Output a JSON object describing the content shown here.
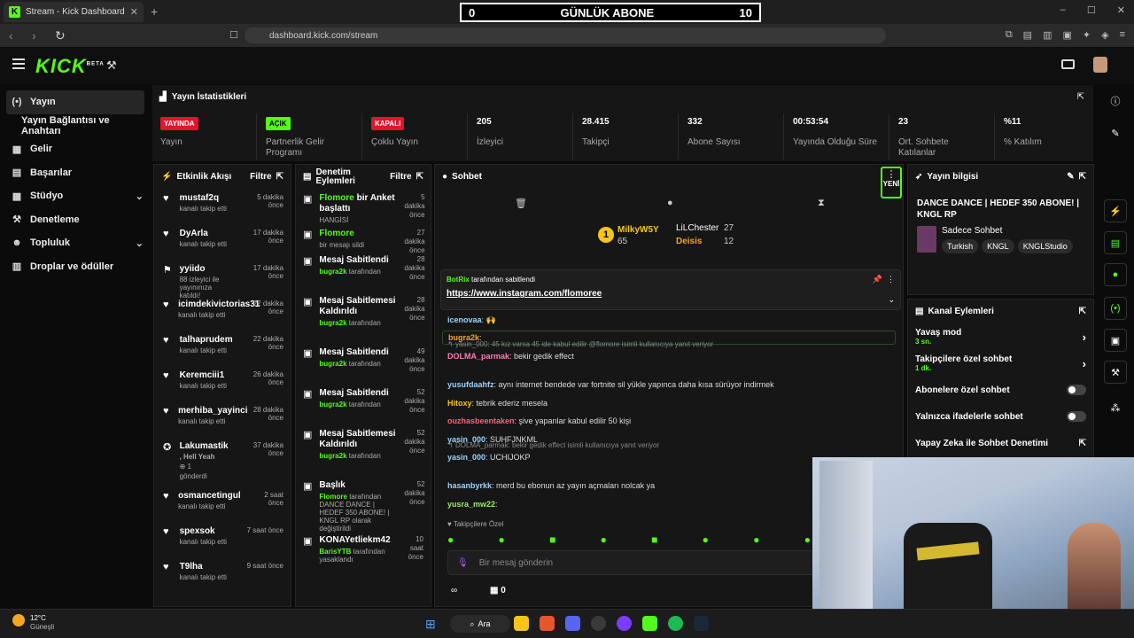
{
  "browser": {
    "tab_title": "Stream - Kick Dashboard",
    "tab_close": "✕",
    "new_tab": "+",
    "url": "dashboard.kick.com/stream",
    "win_min": "–",
    "win_max": "☐",
    "win_close": "✕"
  },
  "overlay": {
    "left": "0",
    "title": "GÜNLÜK ABONE",
    "right": "10"
  },
  "header": {
    "logo": "KICK",
    "logo_sup": "BETA"
  },
  "sidebar": {
    "items": [
      {
        "label": "Yayın",
        "icon": "(•)"
      },
      {
        "label": "Yayın Bağlantısı ve Anahtarı",
        "icon": ""
      },
      {
        "label": "Gelir",
        "icon": "▦"
      },
      {
        "label": "Başarılar",
        "icon": "▤"
      },
      {
        "label": "Stüdyo",
        "icon": "▦"
      },
      {
        "label": "Denetleme",
        "icon": "⚒"
      },
      {
        "label": "Topluluk",
        "icon": "☻"
      },
      {
        "label": "Droplar ve ödüller",
        "icon": "▥"
      }
    ]
  },
  "stats": {
    "title": "Yayın İstatistikleri",
    "items": [
      {
        "badge": "YAYINDA",
        "badge_color": "#e0162b",
        "label": "Yayın"
      },
      {
        "badge": "AÇIK",
        "badge_color": "#53fc18",
        "label": "Partnerlik Gelir Programı"
      },
      {
        "badge": "KAPALI",
        "badge_color": "#e0162b",
        "label": "Çoklu Yayın"
      },
      {
        "value": "205",
        "label": "İzleyici"
      },
      {
        "value": "28.415",
        "label": "Takipçi"
      },
      {
        "value": "332",
        "label": "Abone Sayısı"
      },
      {
        "value": "00:53:54",
        "label": "Yayında Olduğu Süre"
      },
      {
        "value": "23",
        "label": "Ort. Sohbete Katılanlar"
      },
      {
        "value": "%11",
        "label": "% Katılım"
      }
    ]
  },
  "activity": {
    "title": "Etkinlik Akışı",
    "filter": "Filtre",
    "events": [
      {
        "name": "mustaf2q",
        "sub": "kanalı takip etti",
        "time": "5 dakika önce"
      },
      {
        "name": "DyArla",
        "sub": "kanalı takip etti",
        "time": "17 dakika önce"
      },
      {
        "name": "yyiido",
        "sub": "88 izleyici ile yayınınıza katıldı!",
        "time": "17 dakika önce"
      },
      {
        "name": "icimdekivictorias31",
        "sub": "kanalı takip etti",
        "time": "22 dakika önce"
      },
      {
        "name": "talhaprudem",
        "sub": "kanalı takip etti",
        "time": "22 dakika önce"
      },
      {
        "name": "Keremciii1",
        "sub": "kanalı takip etti",
        "time": "26 dakika önce"
      },
      {
        "name": "merhiba_yayinci",
        "sub": "kanalı takip etti",
        "time": "28 dakika önce"
      },
      {
        "name": "Lakumastik",
        "sub": ", Hell Yeah",
        "sub2": "1",
        "sub3": "gönderdi",
        "time": "37 dakika önce"
      },
      {
        "name": "osmancetingul",
        "sub": "kanalı takip etti",
        "time": "2 saat önce"
      },
      {
        "name": "spexsok",
        "sub": "kanalı takip etti",
        "time": "7 saat önce"
      },
      {
        "name": "T9lha",
        "sub": "kanalı takip etti",
        "time": "9 saat önce"
      }
    ]
  },
  "modlog": {
    "title": "Denetim Eylemleri",
    "filter": "Filtre",
    "items": [
      {
        "title1": "Flomore",
        "title2": " bir Anket başlattı",
        "sub": "HANGİSİ",
        "time": "5 dakika önce"
      },
      {
        "title1": "Flomore",
        "title2": "",
        "sub": "bir mesajı sildi",
        "time": "27 dakika önce"
      },
      {
        "title1": "Mesaj Sabitlendi",
        "by": "bugra2k",
        "sub": " tarafından",
        "time": "28 dakika önce"
      },
      {
        "title1": "Mesaj Sabitlemesi Kaldırıldı",
        "by": "bugra2k",
        "sub": " tarafından",
        "time": "28 dakika önce"
      },
      {
        "title1": "Mesaj Sabitlendi",
        "by": "bugra2k",
        "sub": " tarafından",
        "time": "49 dakika önce"
      },
      {
        "title1": "Mesaj Sabitlendi",
        "by": "bugra2k",
        "sub": " tarafından",
        "time": "52 dakika önce"
      },
      {
        "title1": "Mesaj Sabitlemesi Kaldırıldı",
        "by": "bugra2k",
        "sub": " tarafından",
        "time": "52 dakika önce"
      },
      {
        "title1": "Başlık",
        "by": "Flomore",
        "sub": " tarafından DANCE DANCE | HEDEF 350 ABONE! | KNGL RP olarak değiştirildi",
        "time": "52 dakika önce"
      },
      {
        "title1": "KONAYetliekm42",
        "by": "BarisYTB",
        "sub": " tarafından yasaklandı",
        "time": "10 saat önce"
      }
    ]
  },
  "chat": {
    "title": "Sohbet",
    "yeni": "YENİ",
    "top": [
      {
        "rank": "1",
        "name": "MilkyW5Y",
        "count": "65"
      },
      {
        "name": "LiLChester",
        "count": "27"
      },
      {
        "name": "Deisis",
        "count": "12"
      }
    ],
    "pinned": {
      "by": "BotRix",
      "by_suffix": " tarafından sabitlendi",
      "link": "https://www.instagram.com/flomoree"
    },
    "messages": [
      {
        "user": "icenovaa",
        "color": "#9ad3ff",
        "text": ": 🙌"
      },
      {
        "user": "bugra2k",
        "color": "#f5a623",
        "text": ":"
      },
      {
        "reply": "yasin_000: 45 kız varsa 45 ide kabul edilir @flomore isimli kullanıcıya yanıt veriyor",
        "user": "DOLMA_parmak",
        "color": "#ff7ab6",
        "text": ": bekir gedik effect"
      },
      {
        "user": "yusufdaahfz",
        "color": "#9ad3ff",
        "text": ": aynı internet bendede var fortnite sil yükle yapınca daha kısa sürüyor indirmek"
      },
      {
        "user": "Hitoxy",
        "color": "#f5c518",
        "text": ": tebrik ederiz mesela"
      },
      {
        "user": "ouzhasbeentaken",
        "color": "#ff5e7e",
        "text": ": şive yapanlar kabul edilir 50 kişi"
      },
      {
        "user": "yasin_000",
        "color": "#9ad3ff",
        "text": ": SUHFJNKML"
      },
      {
        "reply": "DOLMA_parmak: bekir gedik effect isimli kullanıcıya yanıt veriyor",
        "user": "yasin_000",
        "color": "#9ad3ff",
        "text": ": UCHIJOKP"
      },
      {
        "user": "hasanbyrkk",
        "color": "#9ad3ff",
        "text": ": merd bu ebonun az yayın açmaları nolcak ya"
      },
      {
        "user": "yusra_mw22",
        "color": "#9fe870",
        "text": ":"
      }
    ],
    "followers_only": "Takipçilere Özel",
    "placeholder": "Bir mesaj gönderin",
    "points": "0"
  },
  "info": {
    "title": "Yayın bilgisi",
    "stream_title": "DANCE DANCE | HEDEF 350 ABONE! | KNGL RP",
    "category": "Sadece Sohbet",
    "tags": [
      "Turkish",
      "KNGL",
      "KNGLStudio"
    ]
  },
  "actions": {
    "title": "Kanal Eylemleri",
    "items": [
      {
        "label": "Yavaş mod",
        "sub": "3 sn.",
        "type": "chevron"
      },
      {
        "label": "Takipçilere özel sohbet",
        "sub": "1 dk.",
        "type": "chevron"
      },
      {
        "label": "Abonelere özel sohbet",
        "type": "toggle"
      },
      {
        "label": "Yalnızca ifadelerle sohbet",
        "type": "toggle"
      },
      {
        "label": "Yapay Zeka ile Sohbet Denetimi",
        "type": "link"
      }
    ]
  },
  "taskbar": {
    "weather_temp": "12°C",
    "weather_label": "Güneşli",
    "search": "Ara"
  },
  "colors": {
    "brand": "#53fc18",
    "live": "#e0162b"
  }
}
